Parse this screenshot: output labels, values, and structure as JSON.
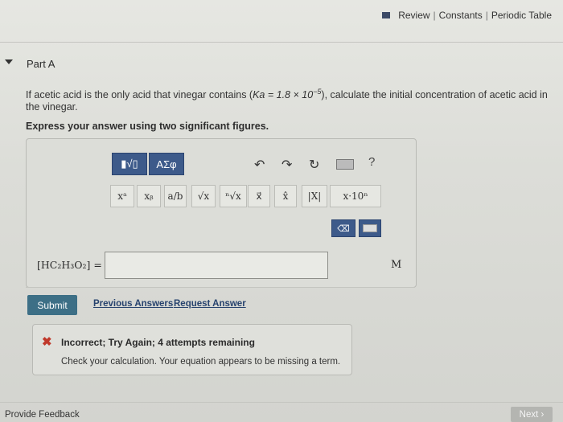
{
  "header": {
    "review": "Review",
    "constants": "Constants",
    "periodic": "Periodic Table",
    "sep": "|"
  },
  "part": {
    "label": "Part A"
  },
  "question": {
    "text_before": "If acetic acid is the only acid that vinegar contains (",
    "ka_expr": "Ka = 1.8 × 10",
    "ka_exp": "−5",
    "text_after": "), calculate the initial concentration of acetic acid in the vinegar.",
    "instruction": "Express your answer using two significant figures."
  },
  "toolbar": {
    "template_label": "▮√▯",
    "greek_label": "ΑΣφ",
    "undo": "↶",
    "redo": "↷",
    "reset": "↻",
    "help": "?"
  },
  "symbols": [
    {
      "name": "superscript-button",
      "label": "xᵃ"
    },
    {
      "name": "subscript-button",
      "label": "xᵦ"
    },
    {
      "name": "fraction-button",
      "label": "a/b"
    },
    {
      "name": "sqrt-button",
      "label": "√x"
    },
    {
      "name": "nth-root-button",
      "label": "ⁿ√x"
    },
    {
      "name": "vector-button",
      "label": "x⃗"
    },
    {
      "name": "hat-button",
      "label": "x̂"
    },
    {
      "name": "abs-button",
      "label": "|X|"
    },
    {
      "name": "sci-notation-button",
      "label": "x·10ⁿ"
    }
  ],
  "answer": {
    "label": "[HC₂H₃O₂] =",
    "value": "",
    "unit": "M"
  },
  "actions": {
    "submit": "Submit",
    "previous": "Previous Answers",
    "request": "Request Answer"
  },
  "feedback": {
    "title": "Incorrect; Try Again; 4 attempts remaining",
    "message": "Check your calculation. Your equation appears to be missing a term."
  },
  "footer": {
    "provide": "Provide Feedback",
    "next": "Next"
  },
  "colors": {
    "accent": "#3d5a8a",
    "submit": "#3d6f86",
    "error": "#c0392b"
  }
}
